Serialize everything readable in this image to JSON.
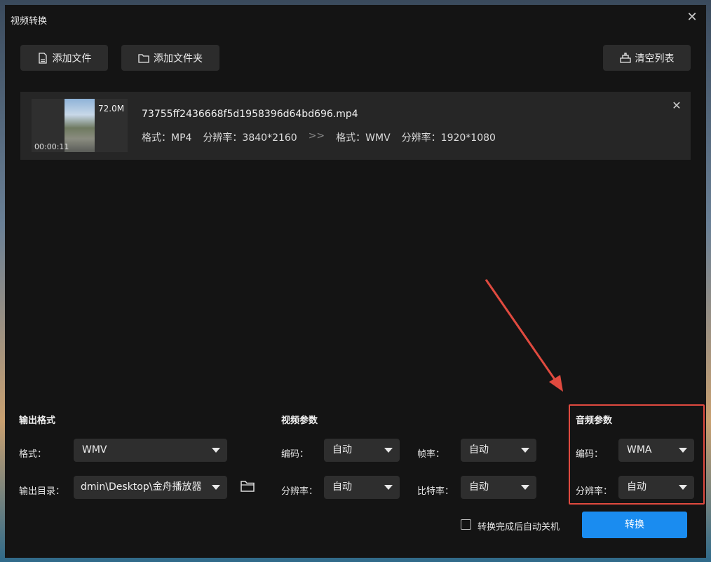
{
  "window": {
    "title": "视频转换"
  },
  "toolbar": {
    "add_file": "添加文件",
    "add_folder": "添加文件夹",
    "clear_list": "清空列表"
  },
  "file": {
    "size": "72.0M",
    "duration": "00:00:11",
    "name": "73755ff2436668f5d1958396d64bd696.mp4",
    "src_format": "格式：MP4",
    "src_resolution": "分辨率：3840*2160",
    "dst_format": "格式：WMV",
    "dst_resolution": "分辨率：1920*1080",
    "arrow": ">>"
  },
  "output": {
    "section_title": "输出格式",
    "format_label": "格式：",
    "format_value": "WMV",
    "dir_label": "输出目录：",
    "dir_value": "dmin\\Desktop\\金舟播放器"
  },
  "video": {
    "section_title": "视频参数",
    "codec_label": "编码：",
    "codec_value": "自动",
    "framerate_label": "帧率：",
    "framerate_value": "自动",
    "resolution_label": "分辨率：",
    "resolution_value": "自动",
    "bitrate_label": "比特率：",
    "bitrate_value": "自动"
  },
  "audio": {
    "section_title": "音频参数",
    "codec_label": "编码：",
    "codec_value": "WMA",
    "resolution_label": "分辨率：",
    "resolution_value": "自动"
  },
  "footer": {
    "auto_shutdown_label": "转换完成后自动关机",
    "convert_button": "转换"
  },
  "colors": {
    "accent": "#1a8cf0",
    "highlight": "#e04a3f"
  }
}
